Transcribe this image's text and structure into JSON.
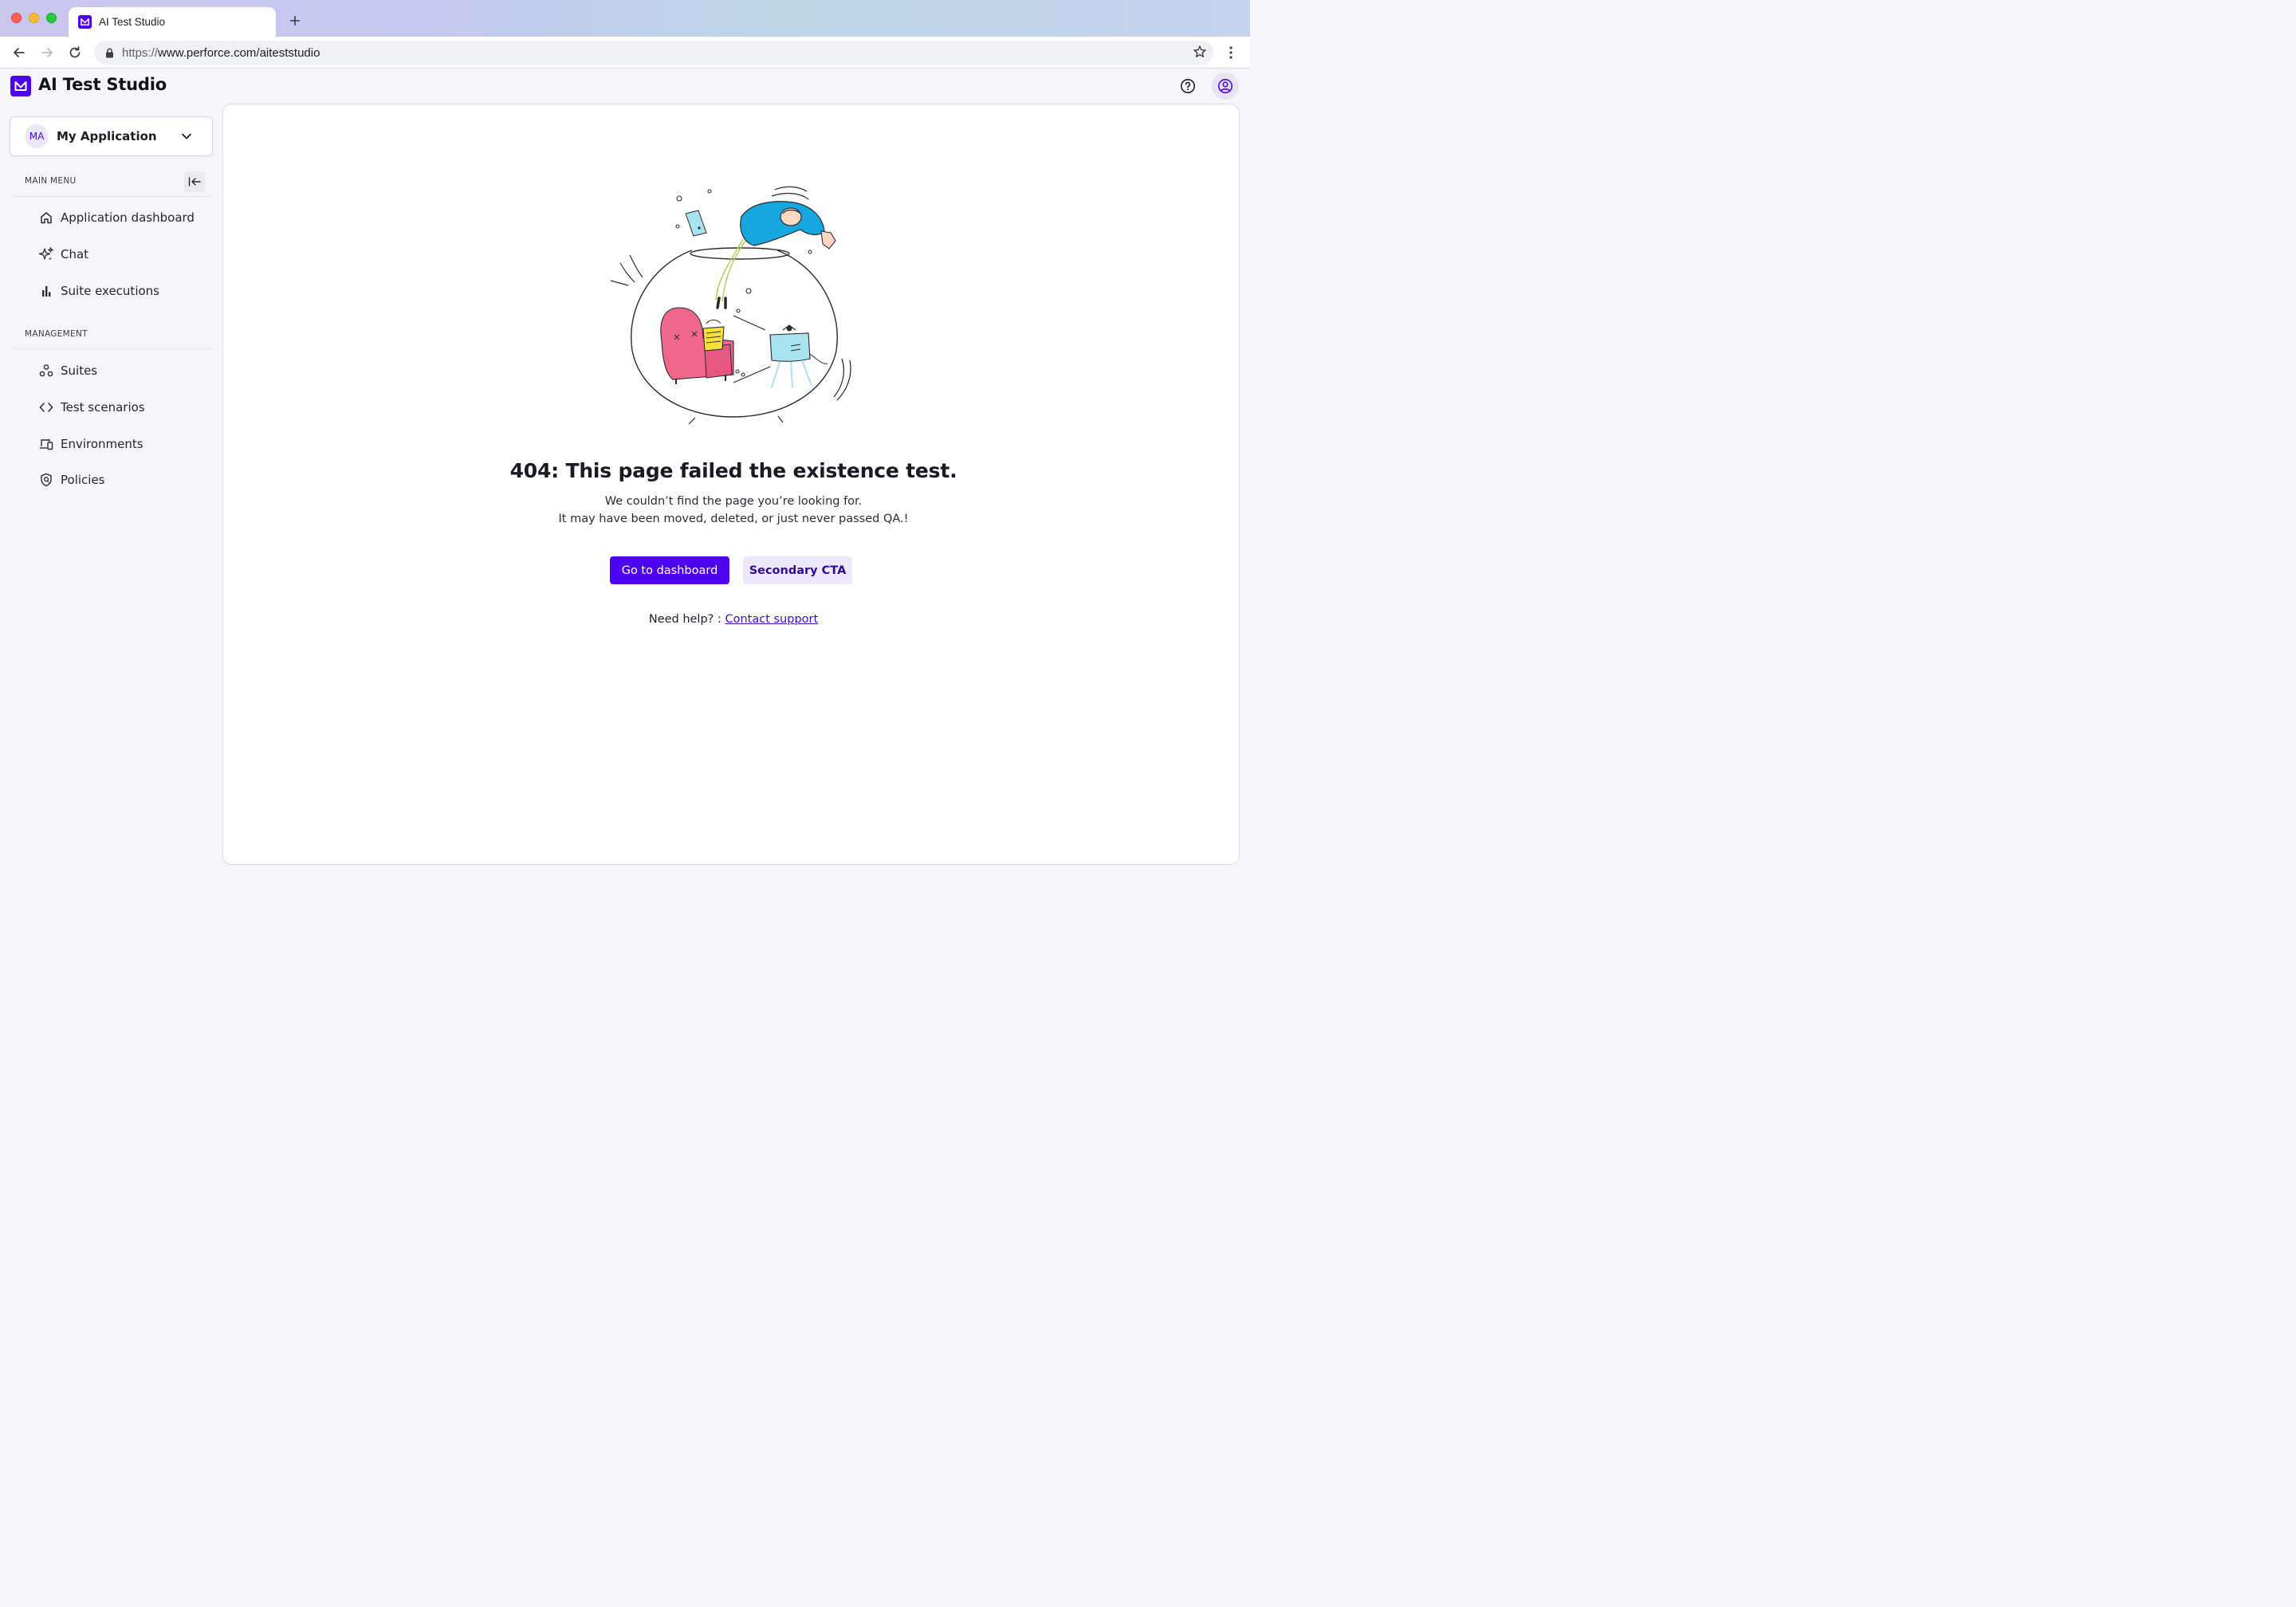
{
  "browser": {
    "tab_title": "AI Test Studio",
    "url_scheme": "https://",
    "url_rest": "www.perforce.com/aiteststudio"
  },
  "header": {
    "app_title": "AI Test Studio"
  },
  "sidebar": {
    "app_selector": {
      "initials": "MA",
      "name": "My Application"
    },
    "main_menu_label": "MAIN MENU",
    "main_items": [
      {
        "label": "Application dashboard",
        "icon": "home-icon"
      },
      {
        "label": "Chat",
        "icon": "sparkle-icon"
      },
      {
        "label": "Suite executions",
        "icon": "bar-chart-icon"
      }
    ],
    "management_label": "MANAGEMENT",
    "management_items": [
      {
        "label": "Suites",
        "icon": "suites-icon"
      },
      {
        "label": "Test scenarios",
        "icon": "code-icon"
      },
      {
        "label": "Environments",
        "icon": "devices-icon"
      },
      {
        "label": "Policies",
        "icon": "shield-icon"
      }
    ]
  },
  "error": {
    "title": "404: This page failed the existence test.",
    "line1": "We couldn’t find the page you’re looking for.",
    "line2": "It may have been moved, deleted, or just never passed QA.!",
    "primary_cta": "Go to dashboard",
    "secondary_cta": "Secondary CTA",
    "help_prefix": "Need help? : ",
    "help_link": "Contact support"
  },
  "colors": {
    "brand": "#4d05f0",
    "secondary_bg": "#ede8fc",
    "link": "#3b0bd8",
    "background": "#f6f5fa"
  }
}
